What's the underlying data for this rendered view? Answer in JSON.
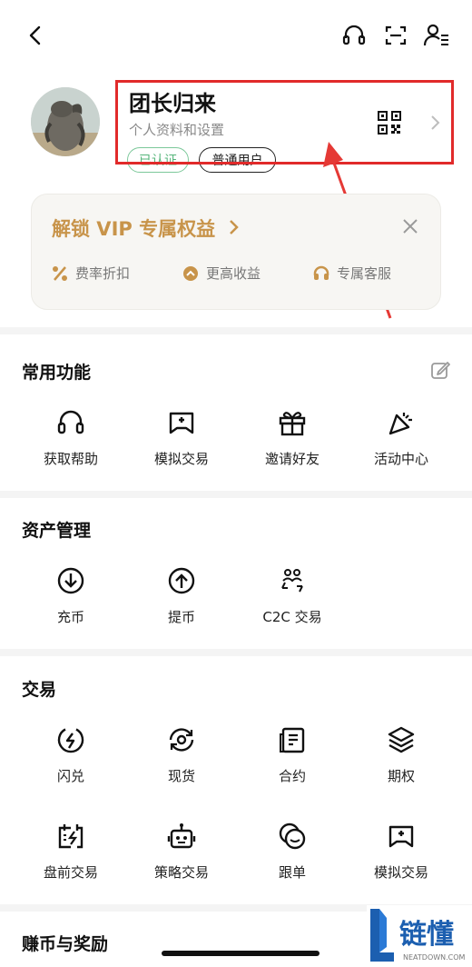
{
  "profile": {
    "username": "团长归来",
    "subtitle": "个人资料和设置",
    "verified_badge": "已认证",
    "user_level_badge": "普通用户"
  },
  "vip": {
    "title": "解锁 VIP 专属权益",
    "perks": [
      "费率折扣",
      "更高收益",
      "专属客服"
    ]
  },
  "sections": {
    "common": {
      "title": "常用功能",
      "items": [
        "获取帮助",
        "模拟交易",
        "邀请好友",
        "活动中心"
      ]
    },
    "assets": {
      "title": "资产管理",
      "items": [
        "充币",
        "提币",
        "C2C 交易"
      ]
    },
    "trade": {
      "title": "交易",
      "items": [
        "闪兑",
        "现货",
        "合约",
        "期权",
        "盘前交易",
        "策略交易",
        "跟单",
        "模拟交易"
      ]
    },
    "earn": {
      "title": "赚币与奖励"
    }
  },
  "watermark": {
    "brand": "链懂",
    "domain": "NEATDOWN.COM"
  },
  "colors": {
    "vip_gold": "#c8944a",
    "verified_green": "#55b57a",
    "highlight_red": "#e12a2a"
  }
}
